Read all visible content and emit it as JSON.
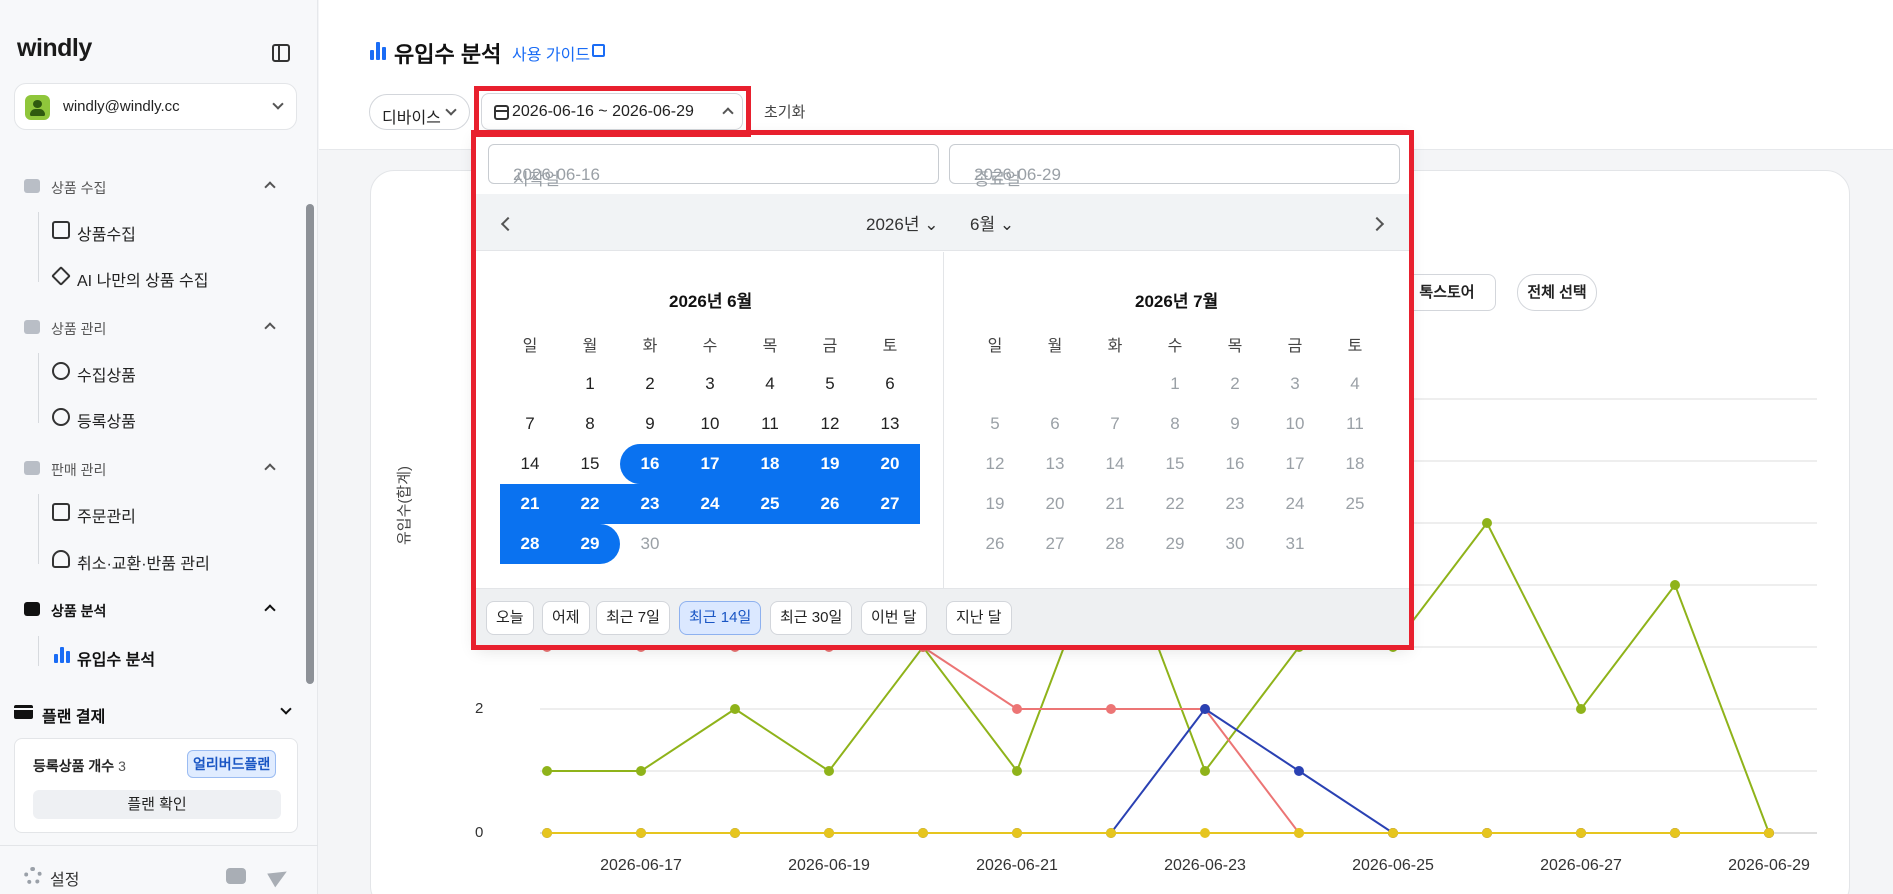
{
  "sidebar": {
    "logo": "windly",
    "account_email": "windly@windly.cc",
    "sections": [
      {
        "label": "상품 수집",
        "items": [
          "상품수집",
          "AI 나만의 상품 수집"
        ]
      },
      {
        "label": "상품 관리",
        "items": [
          "수집상품",
          "등록상품"
        ]
      },
      {
        "label": "판매 관리",
        "items": [
          "주문관리",
          "취소·교환·반품 관리"
        ]
      },
      {
        "label": "상품 분석",
        "items": [
          "유입수 분석"
        ]
      }
    ],
    "plan": {
      "title": "플랜 결제",
      "count_label": "등록상품 개수",
      "count_value": "3",
      "badge": "얼리버드플랜",
      "confirm": "플랜 확인"
    },
    "settings": "설정"
  },
  "header": {
    "title": "유입수 분석",
    "guide": "사용 가이드",
    "device_filter": "디바이스",
    "date_range": "2026-06-16 ~ 2026-06-29",
    "reset": "초기화"
  },
  "chart_panel": {
    "chip_store": "톡스토어",
    "chip_select_all": "전체 선택"
  },
  "picker": {
    "start_placeholder": "시작일",
    "start_value": "2026-06-16",
    "end_placeholder": "종료일",
    "end_value": "2026-06-29",
    "year": "2026년",
    "month": "6월",
    "left_title": "2026년 6월",
    "right_title": "2026년 7월",
    "weekdays": [
      "일",
      "월",
      "화",
      "수",
      "목",
      "금",
      "토"
    ],
    "june_days": [
      "1",
      "2",
      "3",
      "4",
      "5",
      "6",
      "7",
      "8",
      "9",
      "10",
      "11",
      "12",
      "13",
      "14",
      "15",
      "16",
      "17",
      "18",
      "19",
      "20",
      "21",
      "22",
      "23",
      "24",
      "25",
      "26",
      "27",
      "28",
      "29",
      "30"
    ],
    "july_days": [
      "1",
      "2",
      "3",
      "4",
      "5",
      "6",
      "7",
      "8",
      "9",
      "10",
      "11",
      "12",
      "13",
      "14",
      "15",
      "16",
      "17",
      "18",
      "19",
      "20",
      "21",
      "22",
      "23",
      "24",
      "25",
      "26",
      "27",
      "28",
      "29",
      "30",
      "31"
    ],
    "june_first_weekday": 1,
    "july_first_weekday": 3,
    "selected_start": 16,
    "selected_end": 29,
    "presets": [
      "오늘",
      "어제",
      "최근 7일",
      "최근 14일",
      "최근 30일",
      "이번 달",
      "지난 달"
    ],
    "active_preset": "최근 14일"
  },
  "chart_data": {
    "type": "line",
    "ylabel": "유입수(합계)",
    "x": [
      "2026-06-16",
      "2026-06-17",
      "2026-06-18",
      "2026-06-19",
      "2026-06-20",
      "2026-06-21",
      "2026-06-22",
      "2026-06-23",
      "2026-06-24",
      "2026-06-25",
      "2026-06-26",
      "2026-06-27",
      "2026-06-28",
      "2026-06-29"
    ],
    "x_tick_labels": [
      "2026-06-17",
      "2026-06-19",
      "2026-06-21",
      "2026-06-23",
      "2026-06-25",
      "2026-06-27",
      "2026-06-29"
    ],
    "y_tick_labels": [
      "0",
      "2"
    ],
    "ylim": [
      0,
      8
    ],
    "grid": true,
    "series": [
      {
        "color": "#8fb31a",
        "values": [
          1,
          1,
          2,
          1,
          3,
          1,
          5,
          1,
          3,
          3,
          5,
          2,
          4,
          0
        ]
      },
      {
        "color": "#ec7575",
        "values": [
          3,
          3,
          3,
          3,
          3,
          2,
          2,
          2,
          0,
          0,
          0,
          0,
          0,
          0
        ]
      },
      {
        "color": "#2a41b3",
        "values": [
          0,
          0,
          0,
          0,
          0,
          0,
          0,
          2,
          1,
          0,
          0,
          0,
          0,
          0
        ]
      },
      {
        "color": "#e6c51e",
        "values": [
          0,
          0,
          0,
          0,
          0,
          0,
          0,
          0,
          0,
          0,
          0,
          0,
          0,
          0
        ]
      }
    ]
  },
  "colors": {
    "accent": "#1a6cf5",
    "selection": "#0a72f0",
    "highlight_border": "#e8202e"
  }
}
